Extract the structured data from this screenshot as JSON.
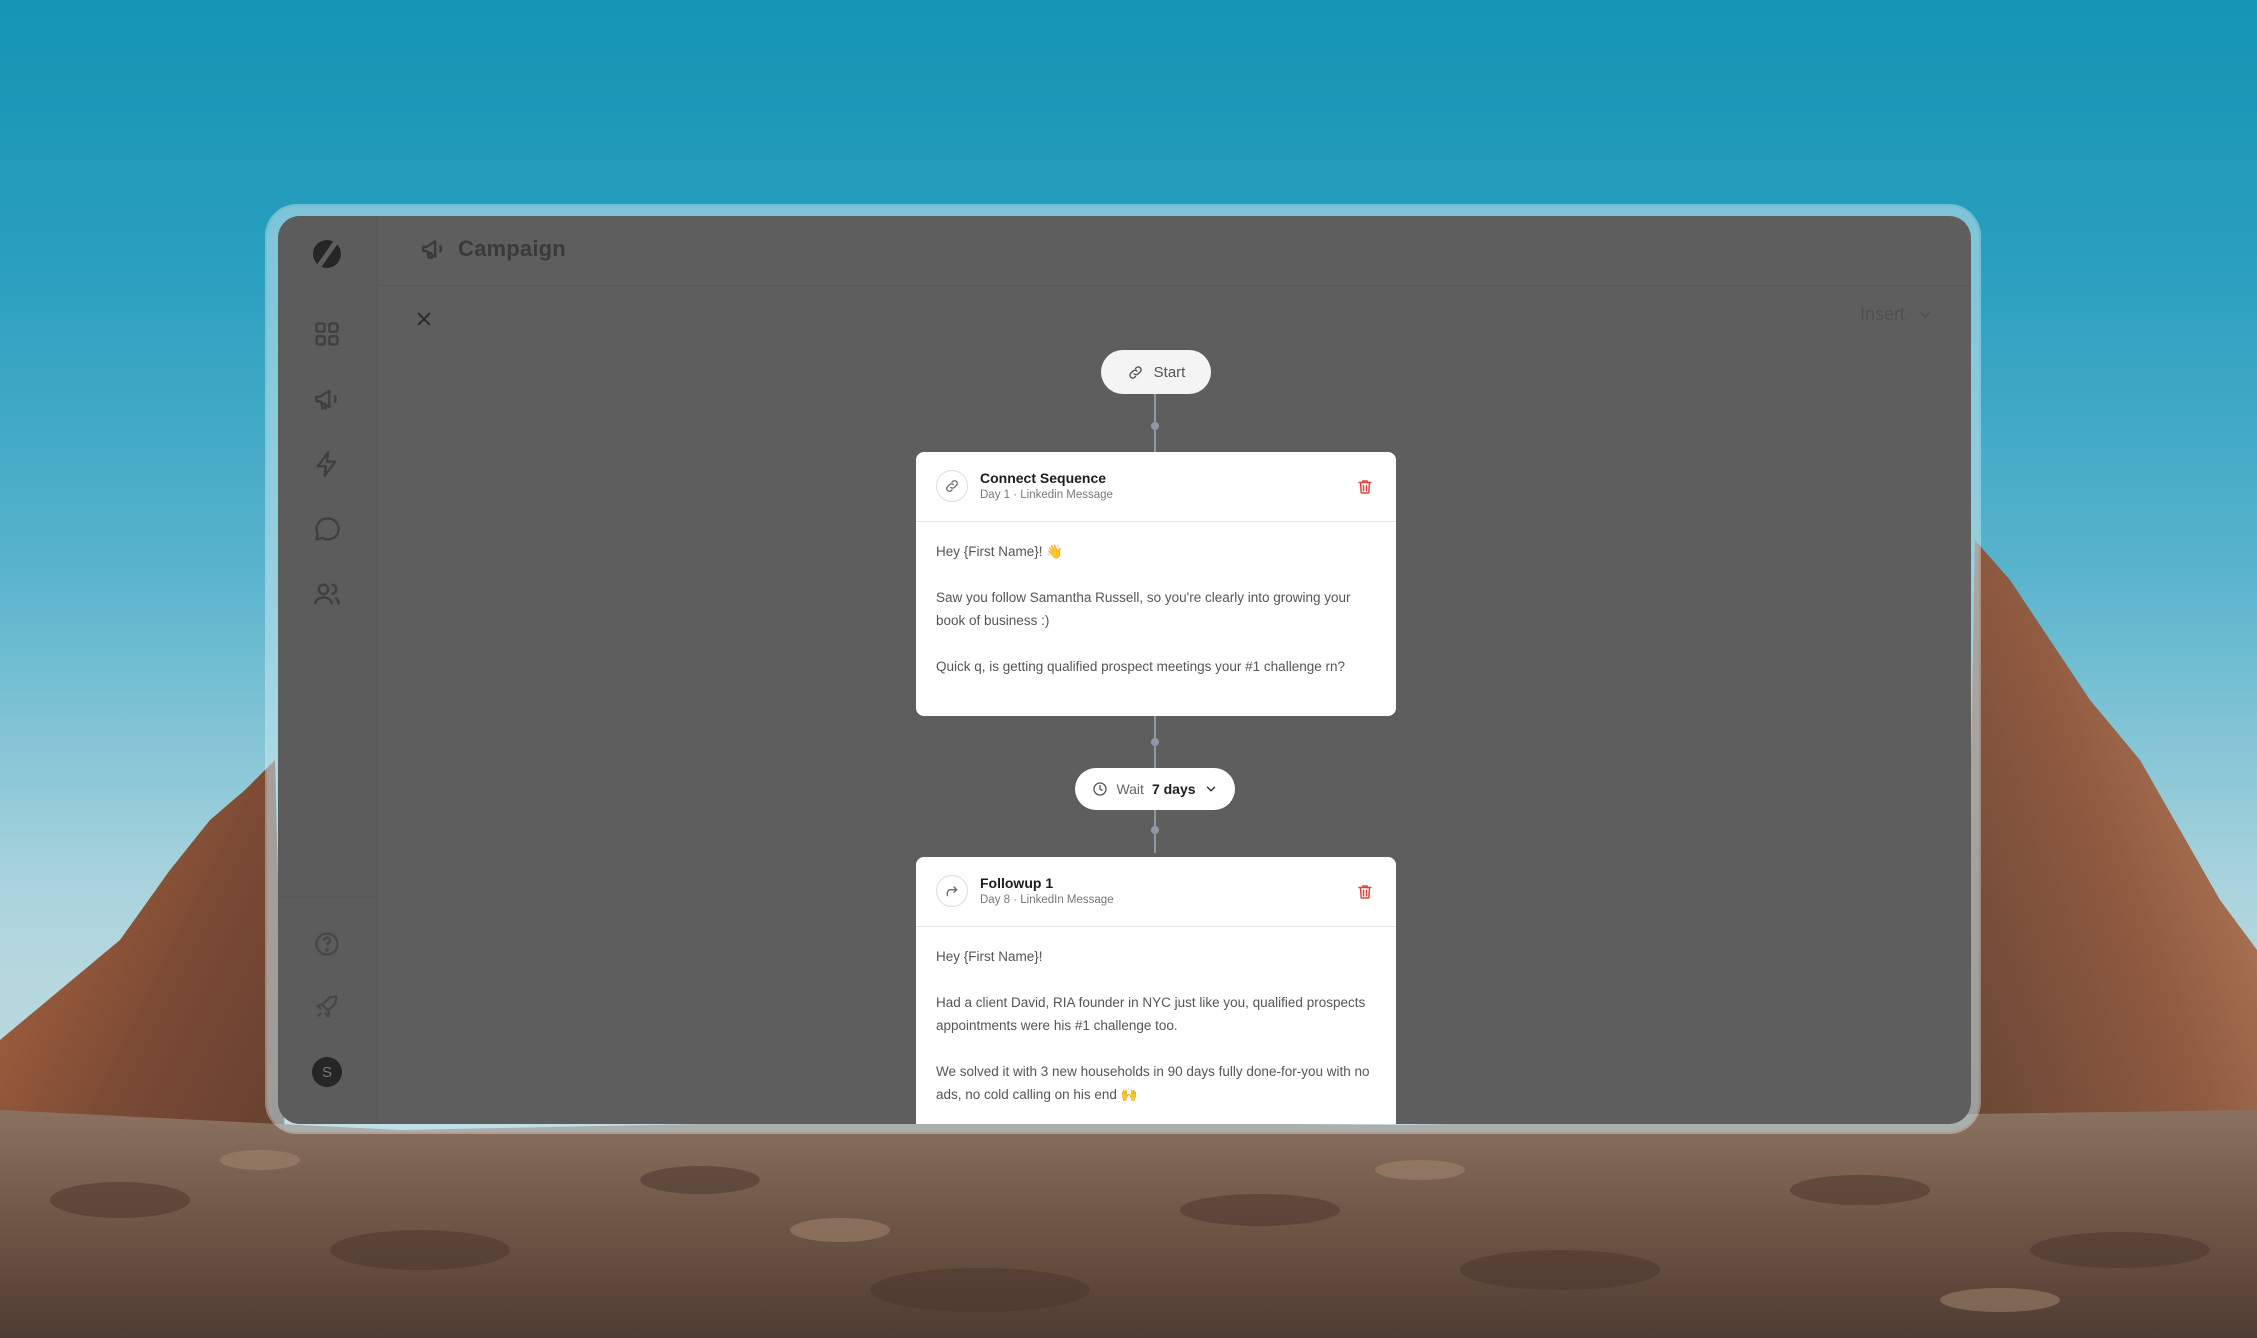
{
  "app": {
    "title": "Campaign",
    "insert_label": "Insert",
    "avatar_letter": "S"
  },
  "sidebar": {
    "items": [
      {
        "icon": "grid-icon"
      },
      {
        "icon": "megaphone-icon"
      },
      {
        "icon": "lightning-icon"
      },
      {
        "icon": "chat-icon"
      },
      {
        "icon": "users-icon"
      }
    ],
    "bottom": [
      {
        "icon": "help-icon"
      },
      {
        "icon": "rocket-icon"
      },
      {
        "icon": "avatar-icon"
      }
    ]
  },
  "flow": {
    "start_label": "Start",
    "steps": [
      {
        "title": "Connect Sequence",
        "subtitle": "Day 1 · Linkedin Message",
        "icon": "link-icon",
        "paragraphs": [
          "Hey {First Name}! 👋",
          "Saw you follow Samantha Russell, so you're clearly into growing your book of business :)",
          "Quick q, is getting qualified prospect meetings your #1 challenge rn?"
        ]
      },
      {
        "title": "Followup 1",
        "subtitle": "Day 8 · LinkedIn Message",
        "icon": "forward-arrow-icon",
        "paragraphs": [
          "Hey {First Name}!",
          "Had a client David, RIA founder in NYC just like you, qualified prospects appointments were his #1 challenge too.",
          "We solved it with 3 new households in 90 days fully done-for-you with no ads, no cold calling on his end 🙌"
        ]
      }
    ],
    "wait": {
      "label": "Wait",
      "value": "7 days"
    }
  },
  "colors": {
    "overlay": "#5e5e5e",
    "card": "#ffffff",
    "delete": "#e0443e",
    "connector": "#8f98a8"
  }
}
